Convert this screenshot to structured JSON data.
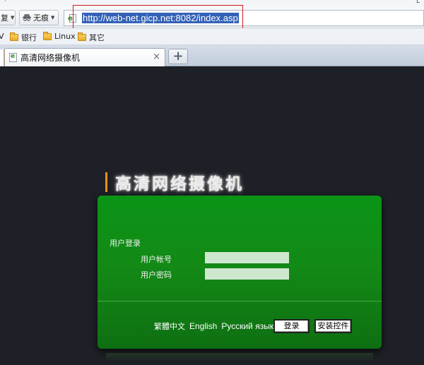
{
  "browser": {
    "top_glyph_left": "·",
    "top_glyph_right": "L",
    "toolbar": {
      "back_label": "复",
      "traceless_label": "无痕",
      "address_url": "http://web-net.gicp.net:8082/index.asp"
    },
    "bookmarks": [
      {
        "label": "V"
      },
      {
        "label": "银行"
      },
      {
        "label": "Linux"
      },
      {
        "label": "其它"
      }
    ],
    "tab": {
      "title": "高清网络摄像机",
      "close_glyph": "×"
    },
    "new_tab_glyph": "+"
  },
  "page": {
    "title": "高清网络摄像机",
    "login": {
      "section_title": "用户登录",
      "username_label": "用户帐号",
      "password_label": "用户密码",
      "username_value": "",
      "password_value": ""
    },
    "languages": [
      "繁體中文",
      "English",
      "Русский язык"
    ],
    "login_button": "登录",
    "install_button": "安装控件"
  },
  "colors": {
    "page_background": "#1d2026",
    "panel_green": "#0e8a14",
    "title_accent": "#e7901a",
    "address_highlight": "#3361b6",
    "annotation_red": "#d31a1a"
  }
}
